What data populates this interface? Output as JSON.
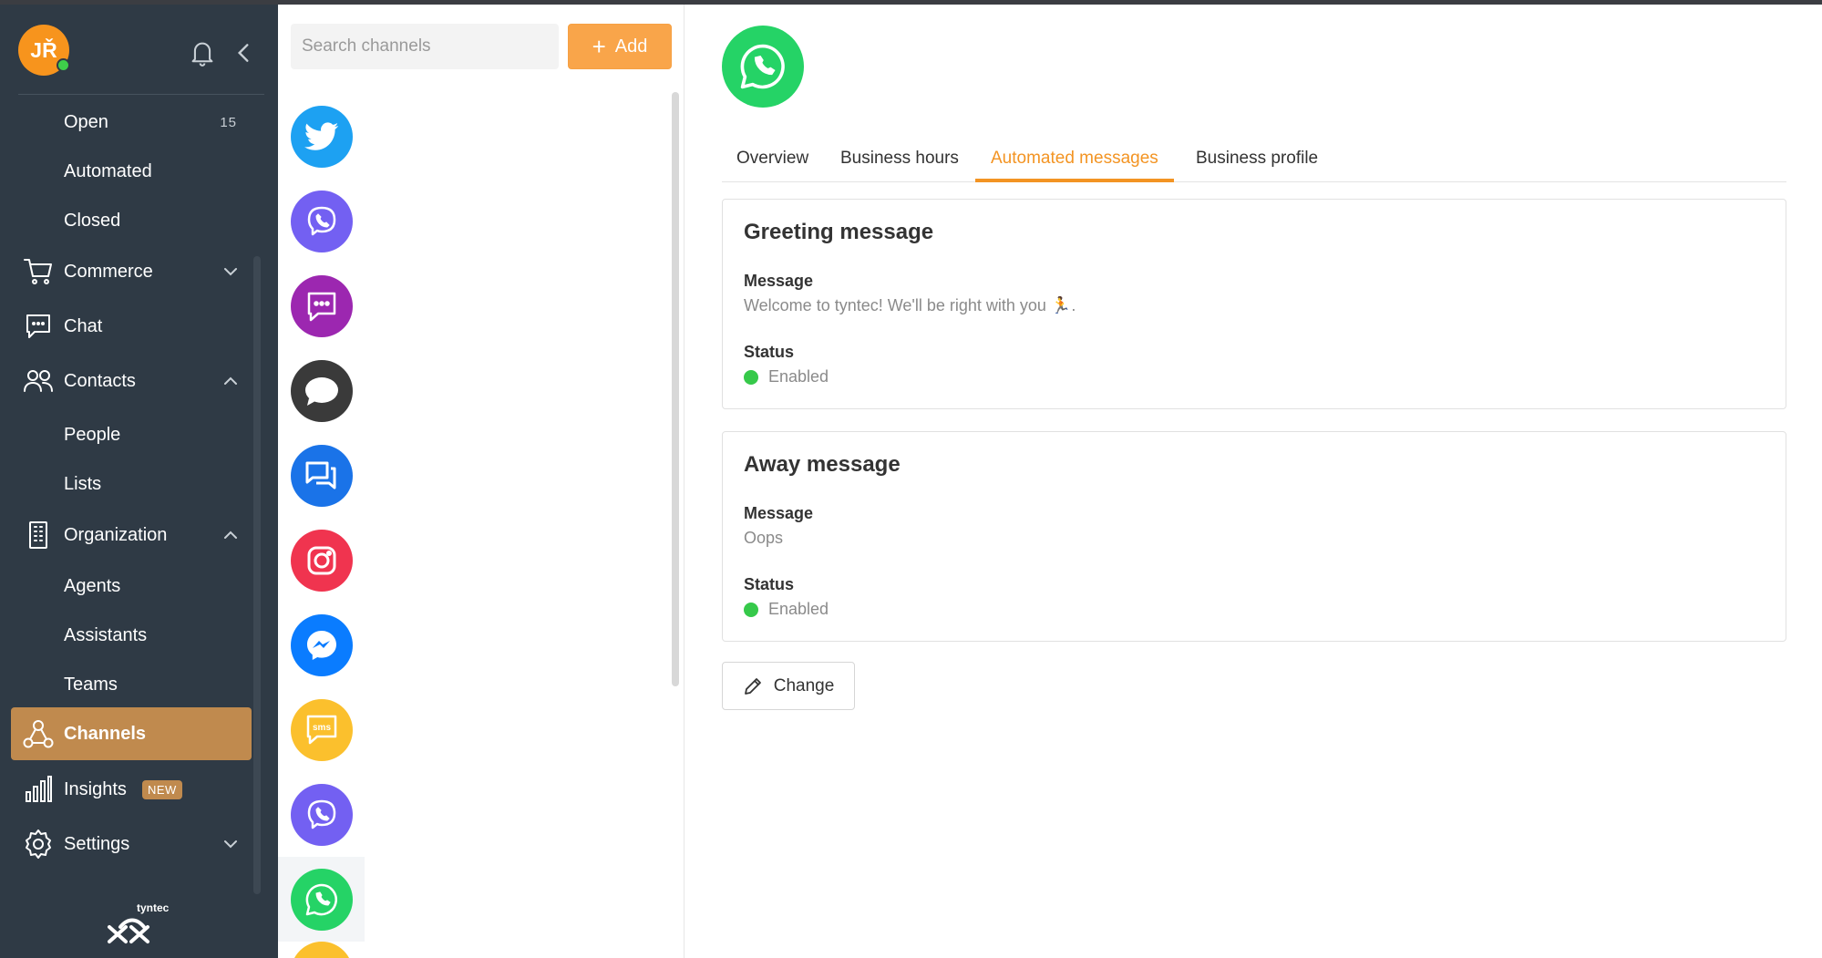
{
  "user": {
    "initials": "JŘ",
    "status": "online"
  },
  "sidebar": {
    "items": [
      {
        "label": "Open",
        "count": "15"
      },
      {
        "label": "Automated"
      },
      {
        "label": "Closed"
      },
      {
        "label": "Commerce",
        "icon": "cart-icon",
        "expandable": "collapsed"
      },
      {
        "label": "Chat",
        "icon": "chat-bubble-icon"
      },
      {
        "label": "Contacts",
        "icon": "people-icon",
        "expandable": "expanded"
      },
      {
        "label": "People"
      },
      {
        "label": "Lists"
      },
      {
        "label": "Organization",
        "icon": "building-icon",
        "expandable": "expanded"
      },
      {
        "label": "Agents"
      },
      {
        "label": "Assistants"
      },
      {
        "label": "Teams"
      },
      {
        "label": "Channels",
        "icon": "channels-icon",
        "active": true
      },
      {
        "label": "Insights",
        "icon": "bar-chart-icon",
        "badge": "NEW"
      },
      {
        "label": "Settings",
        "icon": "gear-icon",
        "expandable": "collapsed"
      }
    ],
    "brand": "tyntec"
  },
  "channels": {
    "search_placeholder": "Search channels",
    "add_label": "Add",
    "list": [
      {
        "type": "twitter",
        "color": "#1da1f2"
      },
      {
        "type": "viber",
        "color": "#7360f2"
      },
      {
        "type": "rcs-chat",
        "color": "#9c27b0"
      },
      {
        "type": "apple-business-chat",
        "color": "#3a3a3a"
      },
      {
        "type": "google-business-messages",
        "color": "#1a73e8"
      },
      {
        "type": "instagram",
        "color": "#f0344f"
      },
      {
        "type": "messenger",
        "color": "#0a7cff"
      },
      {
        "type": "sms",
        "color": "#fbc02d"
      },
      {
        "type": "viber",
        "color": "#7360f2"
      },
      {
        "type": "whatsapp",
        "color": "#25d366",
        "selected": true
      }
    ]
  },
  "detail": {
    "channel": "whatsapp",
    "tabs": [
      {
        "label": "Overview"
      },
      {
        "label": "Business hours"
      },
      {
        "label": "Automated messages",
        "active": true
      },
      {
        "label": "Business profile"
      }
    ],
    "greeting": {
      "title": "Greeting message",
      "message_label": "Message",
      "message": "Welcome to tyntec! We'll be right with you 🏃.",
      "status_label": "Status",
      "status": "Enabled"
    },
    "away": {
      "title": "Away message",
      "message_label": "Message",
      "message": "Oops",
      "status_label": "Status",
      "status": "Enabled"
    },
    "change_label": "Change"
  },
  "colors": {
    "sidebar_bg": "#2f3a45",
    "active_nav": "#c08a4e",
    "accent": "#f39423",
    "add_button": "#f9a54a",
    "enabled": "#36c94a"
  }
}
